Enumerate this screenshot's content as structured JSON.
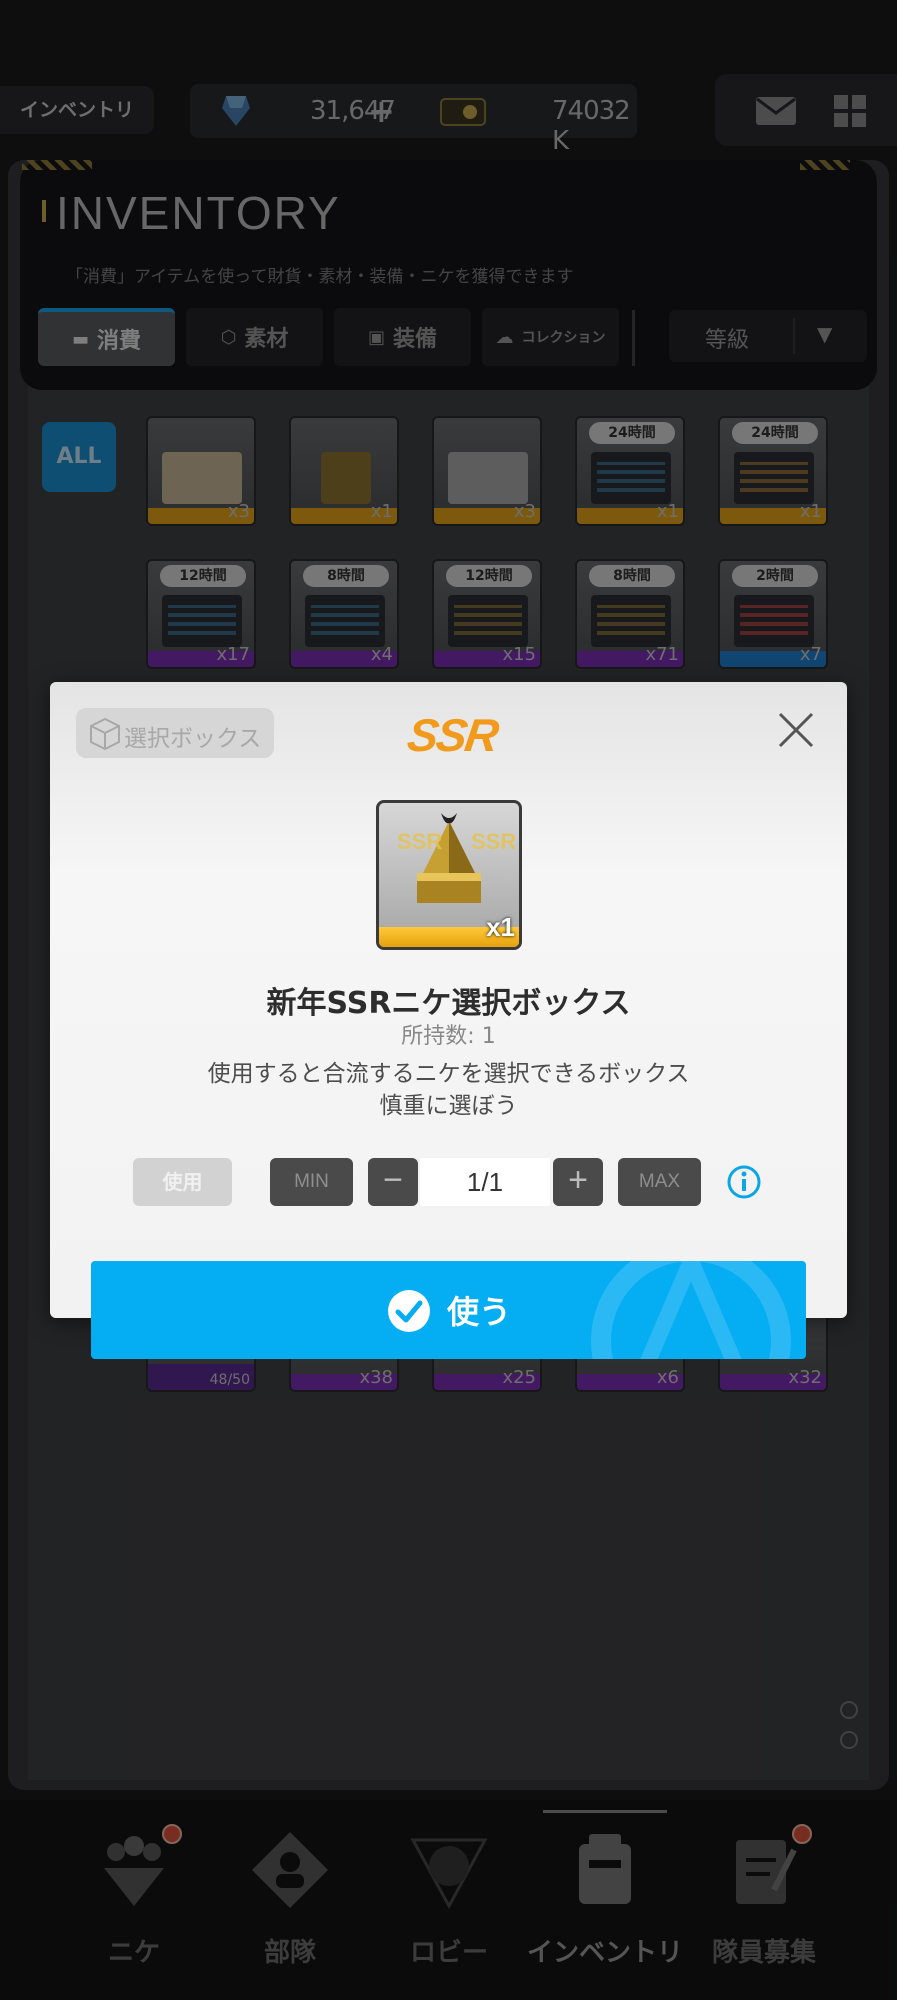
{
  "topbar": {
    "inventory_label": "インベントリ",
    "gems": "31,647",
    "gems_plus": "+",
    "credits": "74032 K"
  },
  "panel": {
    "title": "INVENTORY",
    "subtitle": "「消費」アイテムを使って財貨・素材・装備・ニケを獲得できます",
    "tabs": [
      {
        "label": "消費",
        "icon": "consumable-icon"
      },
      {
        "label": "素材",
        "icon": "material-icon"
      },
      {
        "label": "装備",
        "icon": "equipment-icon"
      },
      {
        "label": "コレクション",
        "icon": "collection-icon"
      }
    ],
    "sort_label": "等級",
    "filter_all": "ALL"
  },
  "items_row1": [
    {
      "tag": "",
      "qty": "x3",
      "band": "#e3a21a"
    },
    {
      "tag": "",
      "qty": "x1",
      "band": "#e3a21a"
    },
    {
      "tag": "",
      "qty": "x3",
      "band": "#e3a21a"
    },
    {
      "tag": "24時間",
      "qty": "x1",
      "band": "#e3a21a"
    },
    {
      "tag": "24時間",
      "qty": "x1",
      "band": "#e3a21a"
    }
  ],
  "items_row2": [
    {
      "tag": "12時間",
      "qty": "x17",
      "band": "#7a2fb5"
    },
    {
      "tag": "8時間",
      "qty": "x4",
      "band": "#7a2fb5"
    },
    {
      "tag": "12時間",
      "qty": "x15",
      "band": "#7a2fb5"
    },
    {
      "tag": "8時間",
      "qty": "x71",
      "band": "#7a2fb5"
    },
    {
      "tag": "2時間",
      "qty": "x7",
      "band": "#1f7fd0"
    }
  ],
  "items_row3": [
    {
      "qty": "48/50"
    },
    {
      "qty": "x38"
    },
    {
      "qty": "x25"
    },
    {
      "qty": "x6"
    },
    {
      "qty": "x32"
    }
  ],
  "modal": {
    "badge": "選択ボックス",
    "rarity": "SSR",
    "item_name": "新年SSRニケ選択ボックス",
    "owned": "所持数: 1",
    "desc_line1": "使用すると合流するニケを選択できるボックス",
    "desc_line2": "慎重に選ぼう",
    "icon_qty": "x1",
    "use_small": "使用",
    "min_label": "MIN",
    "max_label": "MAX",
    "quantity": "1/1",
    "confirm_label": "使う"
  },
  "nav": [
    {
      "label": "ニケ",
      "icon": "nikke-icon",
      "badge": true
    },
    {
      "label": "部隊",
      "icon": "squad-icon",
      "badge": false
    },
    {
      "label": "ロビー",
      "icon": "lobby-icon",
      "badge": false
    },
    {
      "label": "インベントリ",
      "icon": "inventory-icon",
      "badge": false,
      "active": true
    },
    {
      "label": "隊員募集",
      "icon": "recruit-icon",
      "badge": true
    }
  ],
  "colors": {
    "accent_blue": "#05adf2",
    "ssr_orange": "#f29a1c",
    "notification_red": "#d9533a"
  }
}
